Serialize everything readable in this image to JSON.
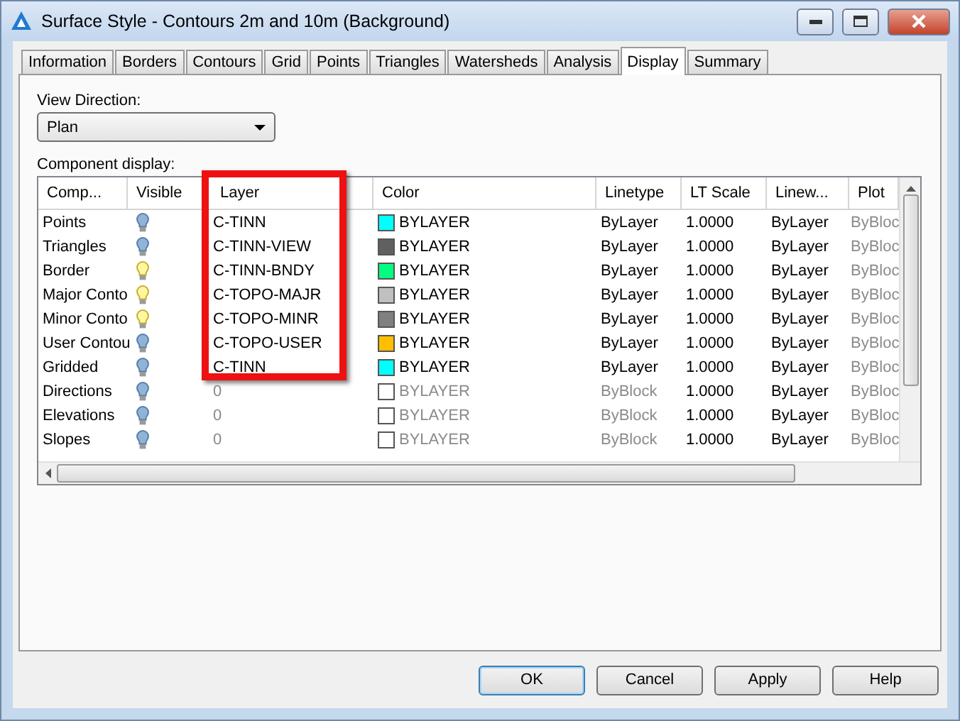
{
  "window": {
    "title": "Surface Style - Contours 2m and 10m (Background)"
  },
  "tabs": [
    {
      "label": "Information",
      "selected": false
    },
    {
      "label": "Borders",
      "selected": false
    },
    {
      "label": "Contours",
      "selected": false
    },
    {
      "label": "Grid",
      "selected": false
    },
    {
      "label": "Points",
      "selected": false
    },
    {
      "label": "Triangles",
      "selected": false
    },
    {
      "label": "Watersheds",
      "selected": false
    },
    {
      "label": "Analysis",
      "selected": false
    },
    {
      "label": "Display",
      "selected": true
    },
    {
      "label": "Summary",
      "selected": false
    }
  ],
  "view_direction": {
    "label": "View Direction:",
    "value": "Plan"
  },
  "component_display": {
    "label": "Component display:",
    "columns": [
      "Comp...",
      "Visible",
      "Layer",
      "Color",
      "Linetype",
      "LT Scale",
      "Linew...",
      "Plot"
    ],
    "rows": [
      {
        "component": "Points",
        "visible": false,
        "layer": "C-TINN",
        "color": "#00ffff",
        "color_label": "BYLAYER",
        "linetype": "ByLayer",
        "lt_scale": "1.0000",
        "lineweight": "ByLayer",
        "plot_style": "ByBloc",
        "dimmed": false
      },
      {
        "component": "Triangles",
        "visible": false,
        "layer": "C-TINN-VIEW",
        "color": "#606060",
        "color_label": "BYLAYER",
        "linetype": "ByLayer",
        "lt_scale": "1.0000",
        "lineweight": "ByLayer",
        "plot_style": "ByBloc",
        "dimmed": false
      },
      {
        "component": "Border",
        "visible": true,
        "layer": "C-TINN-BNDY",
        "color": "#00ff80",
        "color_label": "BYLAYER",
        "linetype": "ByLayer",
        "lt_scale": "1.0000",
        "lineweight": "ByLayer",
        "plot_style": "ByBloc",
        "dimmed": false
      },
      {
        "component": "Major Conto",
        "visible": true,
        "layer": "C-TOPO-MAJR",
        "color": "#c0c0c0",
        "color_label": "BYLAYER",
        "linetype": "ByLayer",
        "lt_scale": "1.0000",
        "lineweight": "ByLayer",
        "plot_style": "ByBloc",
        "dimmed": false
      },
      {
        "component": "Minor Conto",
        "visible": true,
        "layer": "C-TOPO-MINR",
        "color": "#808080",
        "color_label": "BYLAYER",
        "linetype": "ByLayer",
        "lt_scale": "1.0000",
        "lineweight": "ByLayer",
        "plot_style": "ByBloc",
        "dimmed": false
      },
      {
        "component": "User Contou",
        "visible": false,
        "layer": "C-TOPO-USER",
        "color": "#ffbf00",
        "color_label": "BYLAYER",
        "linetype": "ByLayer",
        "lt_scale": "1.0000",
        "lineweight": "ByLayer",
        "plot_style": "ByBloc",
        "dimmed": false
      },
      {
        "component": "Gridded",
        "visible": false,
        "layer": "C-TINN",
        "color": "#00ffff",
        "color_label": "BYLAYER",
        "linetype": "ByLayer",
        "lt_scale": "1.0000",
        "lineweight": "ByLayer",
        "plot_style": "ByBloc",
        "dimmed": false
      },
      {
        "component": "Directions",
        "visible": false,
        "layer": "0",
        "color": "#ffffff",
        "color_label": "BYLAYER",
        "linetype": "ByBlock",
        "lt_scale": "1.0000",
        "lineweight": "ByLayer",
        "plot_style": "ByBloc",
        "dimmed": true
      },
      {
        "component": "Elevations",
        "visible": false,
        "layer": "0",
        "color": "#ffffff",
        "color_label": "BYLAYER",
        "linetype": "ByBlock",
        "lt_scale": "1.0000",
        "lineweight": "ByLayer",
        "plot_style": "ByBloc",
        "dimmed": true
      },
      {
        "component": "Slopes",
        "visible": false,
        "layer": "0",
        "color": "#ffffff",
        "color_label": "BYLAYER",
        "linetype": "ByBlock",
        "lt_scale": "1.0000",
        "lineweight": "ByLayer",
        "plot_style": "ByBloc",
        "dimmed": true
      }
    ]
  },
  "buttons": [
    {
      "label": "OK",
      "default": true
    },
    {
      "label": "Cancel",
      "default": false
    },
    {
      "label": "Apply",
      "default": false
    },
    {
      "label": "Help",
      "default": false
    }
  ]
}
